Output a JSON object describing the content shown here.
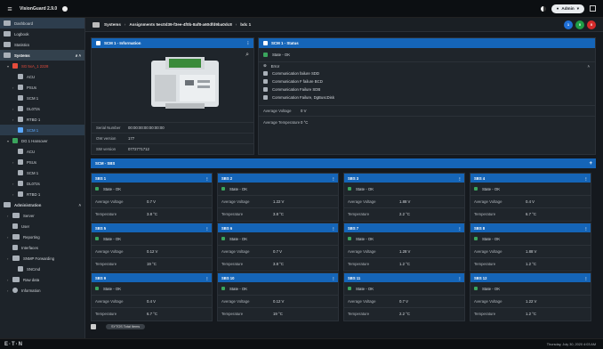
{
  "topbar": {
    "app_name": "VisionGuard 2.9.0",
    "user": "Admin"
  },
  "sidebar": {
    "items": [
      {
        "label": "Dashboard"
      },
      {
        "label": "Logbook"
      },
      {
        "label": "Statistics"
      },
      {
        "label": "Systems"
      },
      {
        "label": "SG 5xA_1 2228"
      },
      {
        "label": "ACU"
      },
      {
        "label": "PSUs"
      },
      {
        "label": "SCM 1"
      },
      {
        "label": "DL072s"
      },
      {
        "label": "RTBD 1"
      },
      {
        "label": "SCM 1"
      },
      {
        "label": "DG 1 Hansover"
      },
      {
        "label": "ACU"
      },
      {
        "label": "PSUs"
      },
      {
        "label": "SCM 1"
      },
      {
        "label": "DL072s"
      },
      {
        "label": "RTBD 1"
      },
      {
        "label": "Administration"
      },
      {
        "label": "Server"
      },
      {
        "label": "User"
      },
      {
        "label": "Reporting"
      },
      {
        "label": "Interfaces"
      },
      {
        "label": "SNMP Forwarding"
      },
      {
        "label": "SNCmd"
      },
      {
        "label": "Raw data"
      },
      {
        "label": "Information"
      }
    ]
  },
  "breadcrumb": {
    "root": "Systems",
    "middle": "Assignments 5ec0d39-f3ee-4f0b-8af8-a60dfd9ba0dc8",
    "leaf": "bdc 1"
  },
  "status_circles": [
    {
      "label": "1",
      "color": "#1f6fd6"
    },
    {
      "label": "0",
      "color": "#1e9d45"
    },
    {
      "label": "0",
      "color": "#d42b2b"
    }
  ],
  "info_panel": {
    "title": "SCM 1 - Information",
    "rows": [
      {
        "k": "Serial Number",
        "v": "00:00:00:00:00:00:00"
      },
      {
        "k": "OW version",
        "v": "177"
      },
      {
        "k": "SW version",
        "v": "0772771712"
      }
    ]
  },
  "status_panel": {
    "title": "SCM 1 - Status",
    "state": "State - OK",
    "section": "Error",
    "errors": [
      "Communication failure SDD",
      "Communication F failure BCD",
      "Communication Failure SDB",
      "Communication Failure, DgBuscDisk"
    ],
    "rows": [
      {
        "k": "Average Voltage",
        "v": "0 V"
      },
      {
        "k": "Average Temperature",
        "v": "0 °C"
      }
    ]
  },
  "sbus": {
    "title": "SCM - SBS"
  },
  "cards": [
    {
      "title": "SBS 1",
      "state": "State - OK",
      "volt": "0.7 V",
      "temp": "3.8 °C"
    },
    {
      "title": "SBS 2",
      "state": "State - OK",
      "volt": "1.22 V",
      "temp": "3.8 °C"
    },
    {
      "title": "SBS 3",
      "state": "State - OK",
      "volt": "1.88 V",
      "temp": "2.2 °C"
    },
    {
      "title": "SBS 4",
      "state": "State - OK",
      "volt": "0.4 V",
      "temp": "6.7 °C"
    },
    {
      "title": "SBS 5",
      "state": "State - OK",
      "volt": "0.12 V",
      "temp": "19 °C"
    },
    {
      "title": "SBS 6",
      "state": "State - OK",
      "volt": "0.7 V",
      "temp": "3.8 °C"
    },
    {
      "title": "SBS 7",
      "state": "State - OK",
      "volt": "1.28 V",
      "temp": "1.2 °C"
    },
    {
      "title": "SBS 8",
      "state": "State - OK",
      "volt": "1.88 V",
      "temp": "1.2 °C"
    },
    {
      "title": "SBS 9",
      "state": "State - OK",
      "volt": "0.4 V",
      "temp": "6.7 °C"
    },
    {
      "title": "SBS 10",
      "state": "State - OK",
      "volt": "0.12 V",
      "temp": "19 °C"
    },
    {
      "title": "SBS 11",
      "state": "State - OK",
      "volt": "0.7 V",
      "temp": "2.2 °C"
    },
    {
      "title": "SBS 12",
      "state": "State - OK",
      "volt": "1.22 V",
      "temp": "1.2 °C"
    }
  ],
  "labels": {
    "avg_voltage": "Average Voltage",
    "temperature": "Temperature"
  },
  "bottom": {
    "tab": "SYTOS Total Items",
    "brand": "E·T·N",
    "time": "Thursday, July 30, 2020 4:03 AM"
  }
}
